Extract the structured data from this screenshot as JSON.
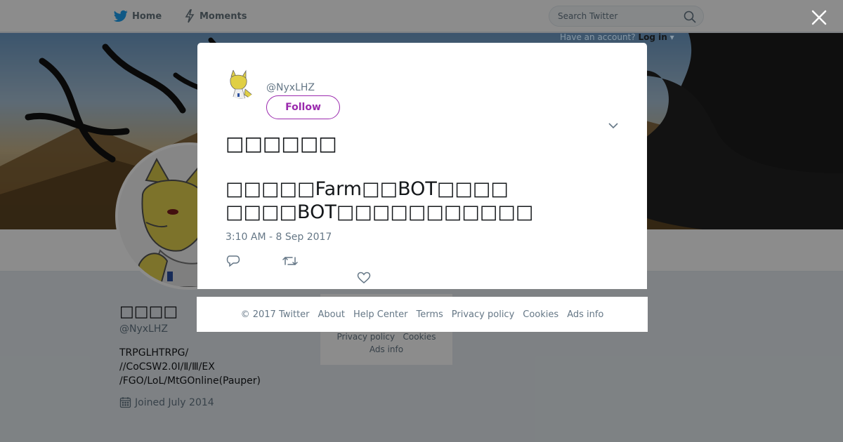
{
  "nav": {
    "home_label": "Home",
    "moments_label": "Moments",
    "search_placeholder": "Search Twitter",
    "have_account": "Have an account?",
    "login_label": "Log in"
  },
  "profile": {
    "display_name": "□□□□",
    "handle": "@NyxLHZ",
    "bio_lines": [
      "TRPGLHTRPG/",
      "//CoCSW2.0Ⅰ/Ⅱ/Ⅲ/EX",
      "/FGO/LoL/MtGOnline(Pauper)"
    ],
    "joined": "Joined July 2014"
  },
  "side_footer": {
    "line1_a": "Privacy policy",
    "line1_b": "Cookies",
    "line2": "Ads info"
  },
  "tweet": {
    "handle": "@NyxLHZ",
    "follow_label": "Follow",
    "author_name": "□□□□□□",
    "text_line1": "□□□□□Farm□□BOT□□□□",
    "text_line2": "□□□□BOT□□□□□□□□□□□",
    "timestamp": "3:10 AM - 8 Sep 2017"
  },
  "footer": {
    "copyright": "© 2017 Twitter",
    "links": [
      "About",
      "Help Center",
      "Terms",
      "Privacy policy",
      "Cookies",
      "Ads info"
    ]
  },
  "colors": {
    "accent": "#9b2aae",
    "twitter_blue": "#1da1f2",
    "muted_text": "#657786"
  },
  "icons": {
    "home": "twitter-bird-icon",
    "moments": "lightning-icon",
    "search": "search-icon",
    "close": "close-icon",
    "chevron": "chevron-down-icon",
    "reply": "reply-icon",
    "retweet": "retweet-icon",
    "like": "heart-icon",
    "calendar": "calendar-icon"
  }
}
